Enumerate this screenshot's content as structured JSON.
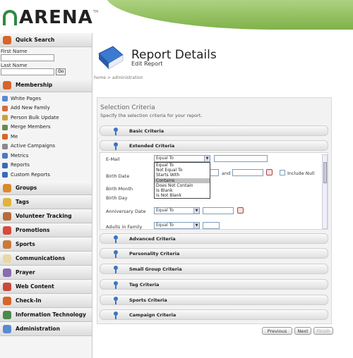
{
  "header": {
    "logo_text": "ARENA",
    "logo_sup": "TM"
  },
  "sidebar": {
    "quick_search": {
      "title": "Quick Search",
      "first_name_label": "First Name",
      "last_name_label": "Last Name",
      "go_label": "Go"
    },
    "membership_label": "Membership",
    "membership_items": [
      "White Pages",
      "Add New Family",
      "Person Bulk Update",
      "Merge Members",
      "Me",
      "Active Campaigns",
      "Metrics",
      "Reports",
      "Custom Reports"
    ],
    "sections": [
      "Groups",
      "Tags",
      "Volunteer Tracking",
      "Promotions",
      "Sports",
      "Communications",
      "Prayer",
      "Web Content",
      "Check-In",
      "Information Technology",
      "Administration"
    ]
  },
  "page": {
    "breadcrumb": "home > administration",
    "title": "Report Details",
    "subtitle": "Edit Report"
  },
  "panel": {
    "title": "Selection Criteria",
    "description": "Specify the selection criteria for your report.",
    "basic": "Basic Criteria",
    "extended": "Extended Criteria",
    "fields": {
      "email": "E-Mail",
      "birth_date": "Birth Date",
      "birth_month": "Birth Month",
      "birth_day": "Birth Day",
      "anniversary": "Anniversary Date",
      "adults": "Adults in Family"
    },
    "equal_to": "Equal To",
    "and_label": "and",
    "include_null": "Include Null",
    "dropdown_options": [
      "Equal To",
      "Not Equal To",
      "Starts With",
      "Contains",
      "Does Not Contain",
      "Is Blank",
      "Is Not Blank"
    ],
    "dropdown_selected": "Contains",
    "categories": [
      "Advanced Criteria",
      "Personality Criteria",
      "Small Group Criteria",
      "Tag Criteria",
      "Sports Criteria",
      "Campaign Criteria"
    ]
  },
  "buttons": {
    "previous": "Previous",
    "next": "Next",
    "finish": "Finish"
  }
}
